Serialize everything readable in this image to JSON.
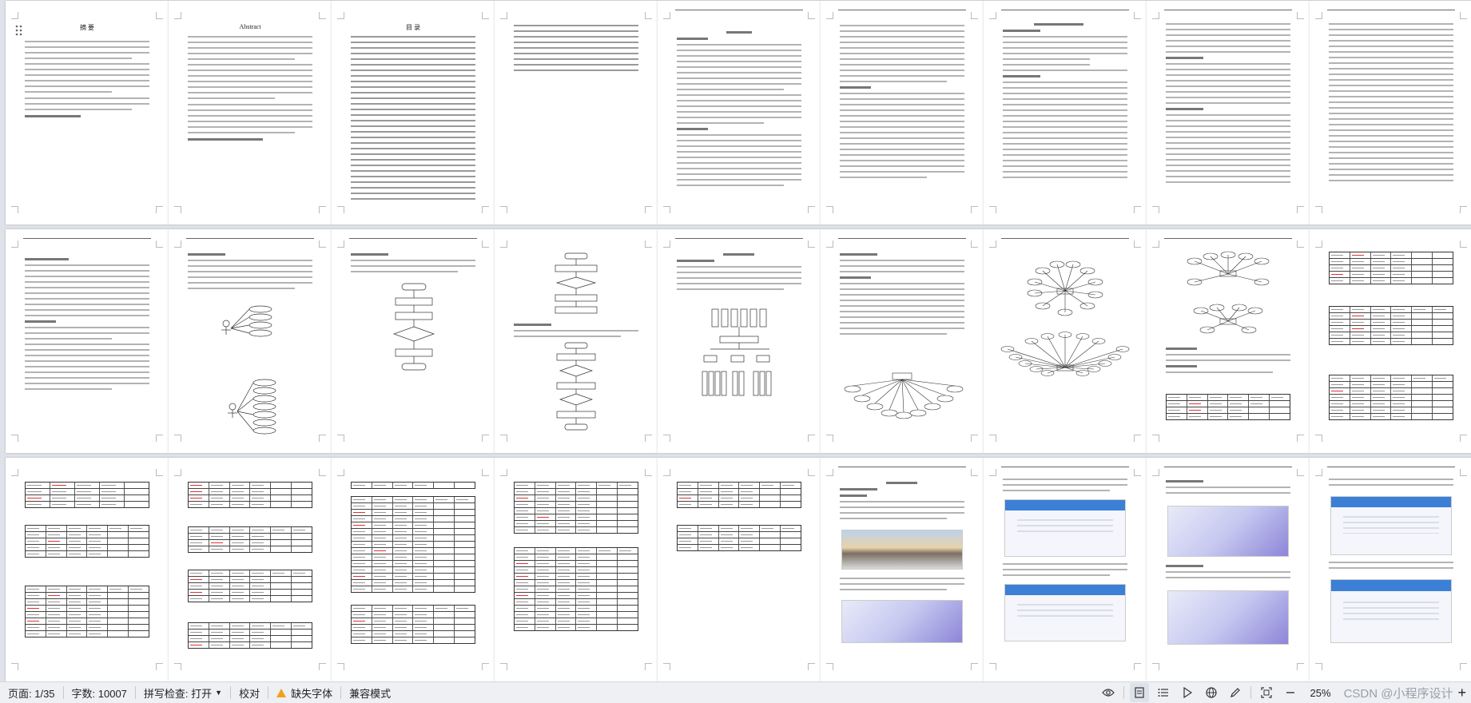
{
  "status_bar": {
    "page_label": "页面: 1/35",
    "word_count": "字数: 10007",
    "spell_check": "拼写检查: 打开",
    "proofread": "校对",
    "missing_fonts": "缺失字体",
    "compat_mode": "兼容模式",
    "zoom": "25%",
    "watermark": "CSDN @小程序设计"
  },
  "pages": {
    "abstract_cn": {
      "title": "摘 要"
    },
    "abstract_en": {
      "title": "Abstract"
    },
    "toc": {
      "title": "目 录"
    }
  },
  "icons": [
    "outline-icon",
    "eye-icon",
    "page-view-icon",
    "list-icon",
    "play-icon",
    "globe-icon",
    "pen-icon",
    "fit-icon",
    "minus-icon",
    "plus-icon",
    "warning-icon"
  ]
}
